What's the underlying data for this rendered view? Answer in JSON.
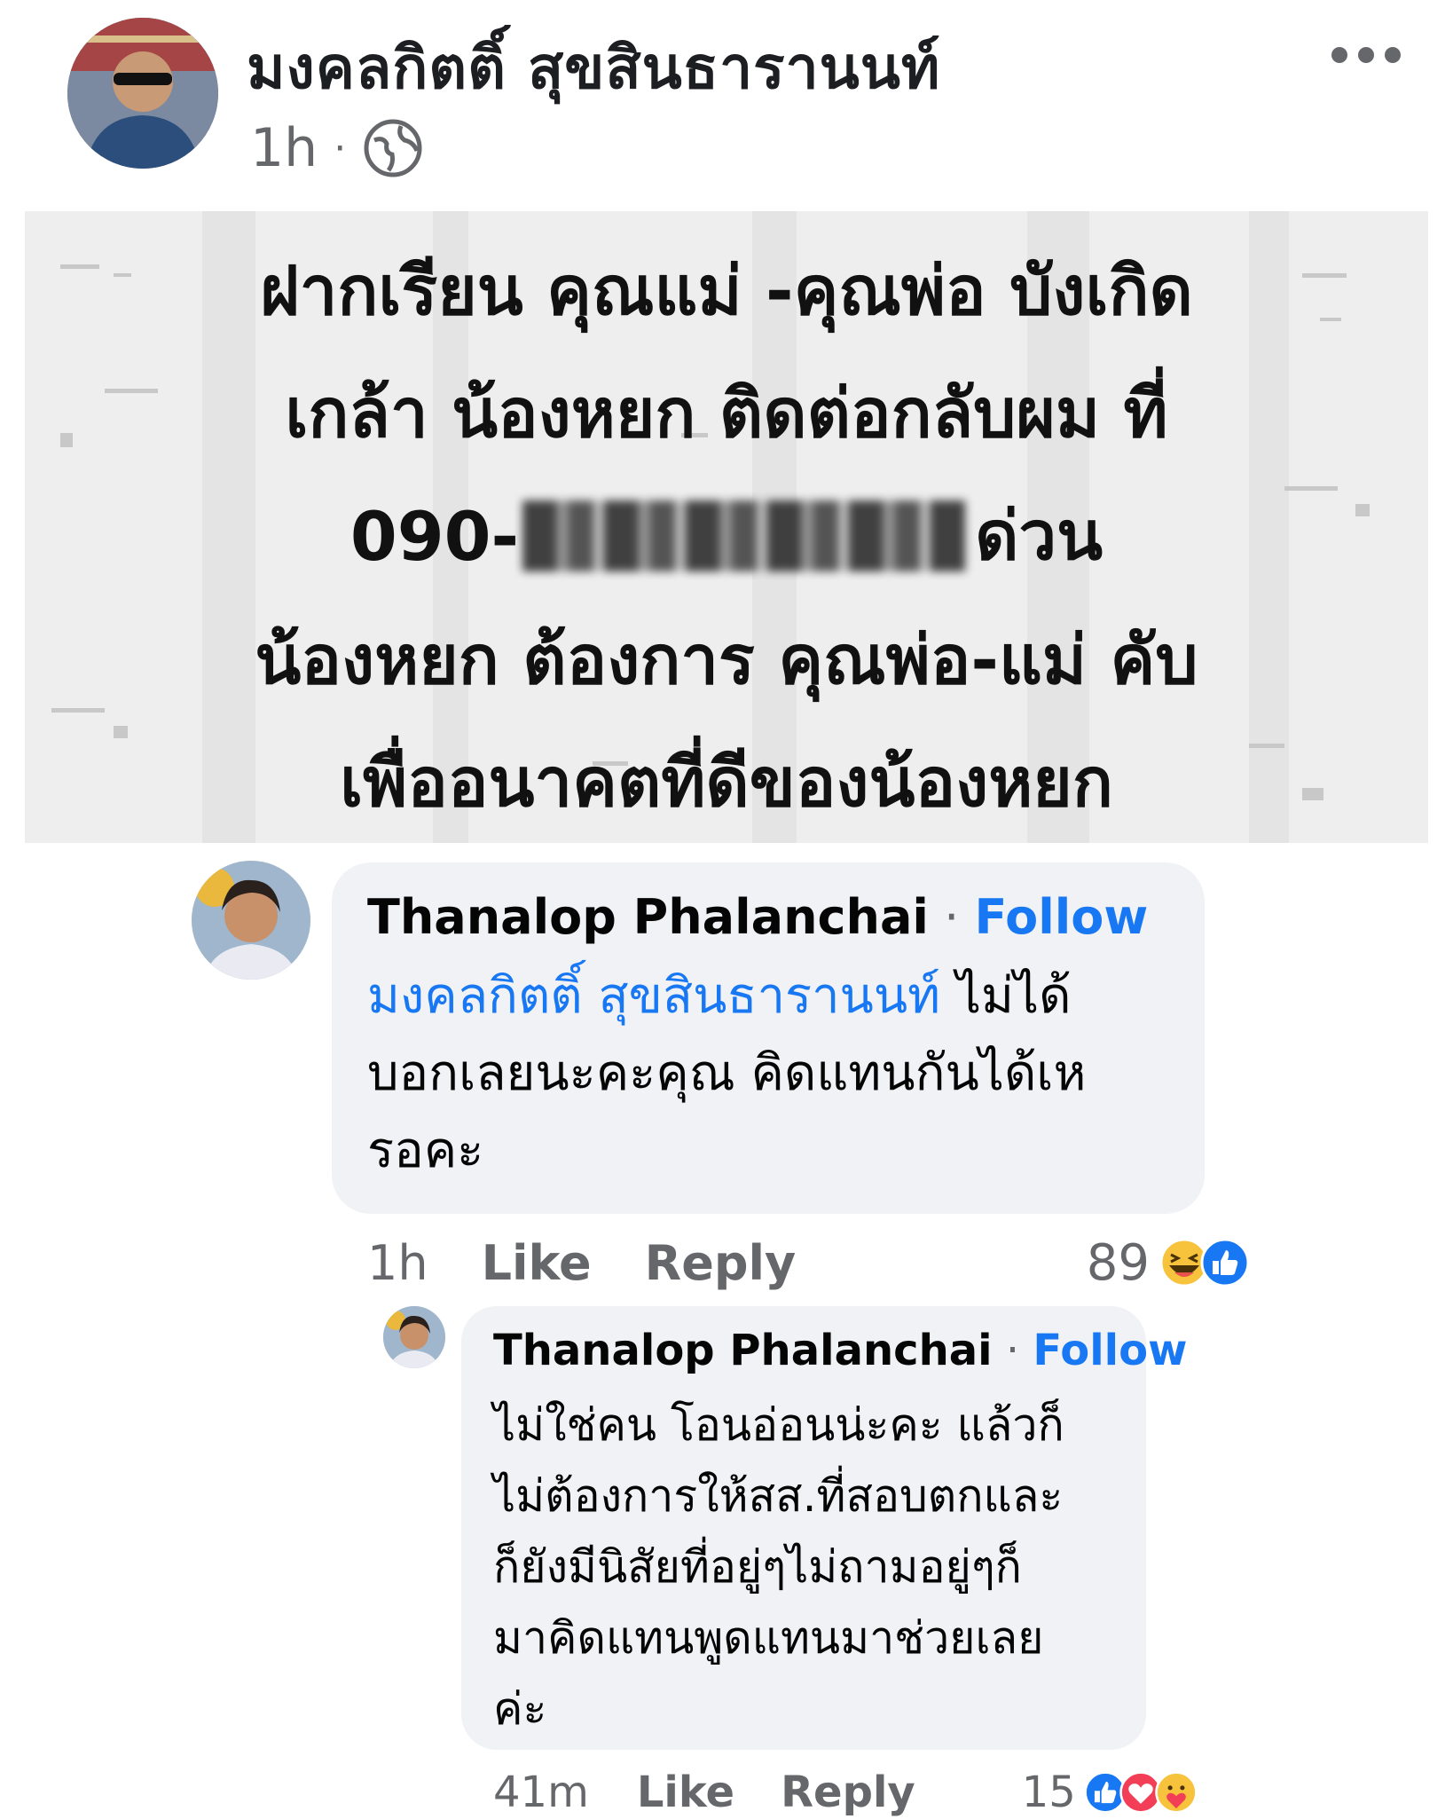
{
  "post": {
    "author": "มงคลกิตติ์ สุขสินธารานนท์",
    "time": "1h",
    "separator": "·",
    "privacy_icon": "globe-icon",
    "more_icon": "more-horizontal-icon",
    "image_text": {
      "line1": "ฝากเรียน คุณแม่ -คุณพ่อ บังเกิด",
      "line2": "เกล้า น้องหยก ติดต่อกลับผม ที่",
      "phone_prefix": "090-",
      "line3_suffix": "ด่วน",
      "line4": "น้องหยก ต้องการ คุณพ่อ-แม่ คับ",
      "line5": "เพื่ออนาคตที่ดีของน้องหยก"
    }
  },
  "comments": [
    {
      "author": "Thanalop Phalanchai",
      "separator": "·",
      "follow_label": "Follow",
      "mention": "มงคลกิตติ์ สุขสินธารานนท์",
      "text_line1_rest": " ไม่ได้",
      "text_line2": "บอกเลยนะคะคุณ คิดแทนกันได้เห",
      "text_line3": "รอคะ",
      "time": "1h",
      "like_label": "Like",
      "reply_label": "Reply",
      "reaction_count": "89",
      "reactions": [
        "haha-icon",
        "like-icon"
      ]
    },
    {
      "author": "Thanalop Phalanchai",
      "separator": "·",
      "follow_label": "Follow",
      "text_lines": [
        "ไม่ใช่คน โอนอ่อนน่ะคะ แล้วก็",
        "ไม่ต้องการให้สส.ที่สอบตกและ",
        "ก็ยังมีนิสัยที่อยู่ๆไม่ถามอยู่ๆก็",
        "มาคิดแทนพูดแทนมาช่วยเลย",
        "ค่ะ"
      ],
      "time": "41m",
      "like_label": "Like",
      "reply_label": "Reply",
      "reaction_count": "15",
      "reactions": [
        "like-icon",
        "love-icon",
        "care-icon"
      ]
    }
  ],
  "colors": {
    "link_blue": "#1877f2",
    "bubble_bg": "#f0f2f5",
    "meta_gray": "#65676b"
  }
}
